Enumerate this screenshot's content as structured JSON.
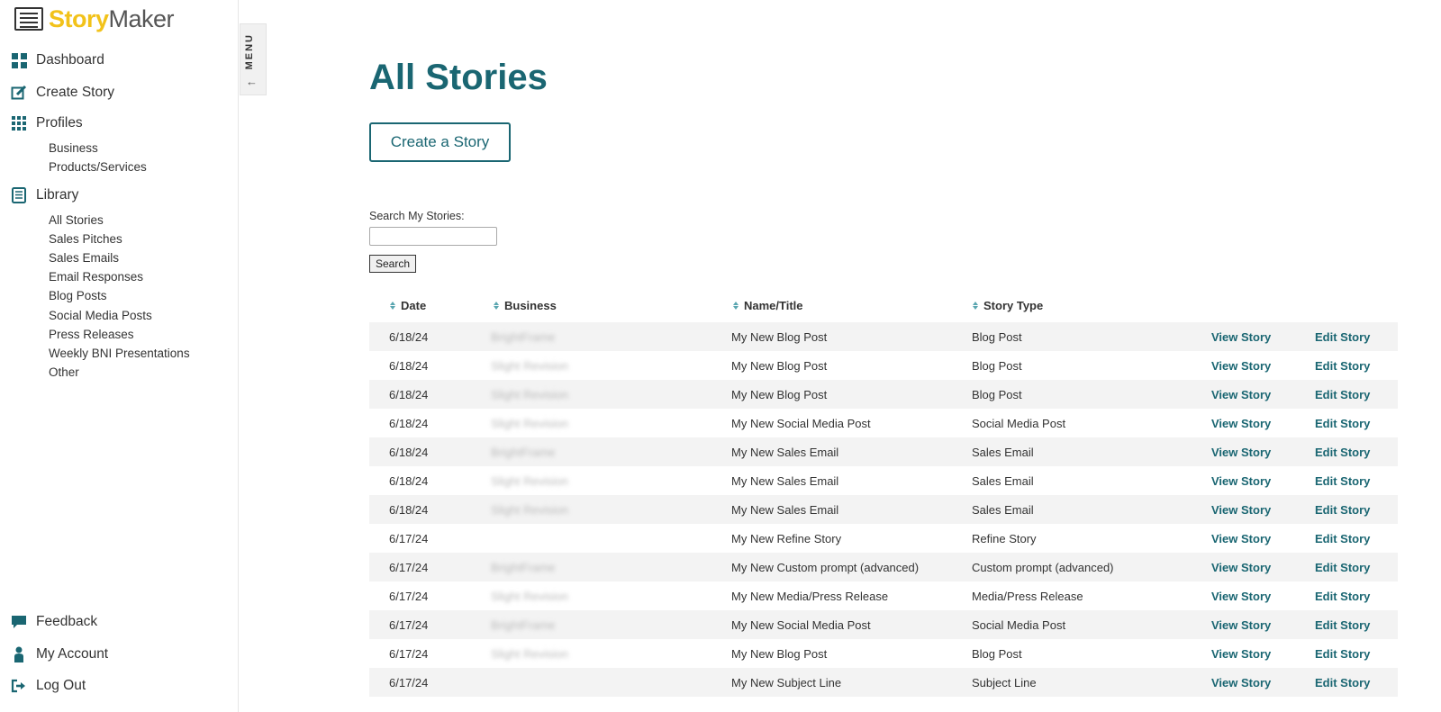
{
  "app": {
    "logo_part1": "Story",
    "logo_part2": "Maker"
  },
  "sidebar": {
    "dashboard": "Dashboard",
    "create_story": "Create Story",
    "profiles": "Profiles",
    "profiles_items": [
      "Business",
      "Products/Services"
    ],
    "library": "Library",
    "library_items": [
      "All Stories",
      "Sales Pitches",
      "Sales Emails",
      "Email Responses",
      "Blog Posts",
      "Social Media Posts",
      "Press Releases",
      "Weekly BNI Presentations",
      "Other"
    ],
    "feedback": "Feedback",
    "my_account": "My Account",
    "log_out": "Log Out"
  },
  "menu_tab": {
    "label": "MENU",
    "arrow": "←"
  },
  "main": {
    "title": "All Stories",
    "create_button": "Create a Story",
    "search_label": "Search My Stories:",
    "search_value": "",
    "search_button": "Search"
  },
  "table": {
    "headers": {
      "date": "Date",
      "business": "Business",
      "name": "Name/Title",
      "type": "Story Type"
    },
    "view_label": "View Story",
    "edit_label": "Edit Story",
    "rows": [
      {
        "date": "6/18/24",
        "business": "BrightFrame",
        "name": "My New Blog Post",
        "type": "Blog Post"
      },
      {
        "date": "6/18/24",
        "business": "Slight Revision",
        "name": "My New Blog Post",
        "type": "Blog Post"
      },
      {
        "date": "6/18/24",
        "business": "Slight Revision",
        "name": "My New Blog Post",
        "type": "Blog Post"
      },
      {
        "date": "6/18/24",
        "business": "Slight Revision",
        "name": "My New Social Media Post",
        "type": "Social Media Post"
      },
      {
        "date": "6/18/24",
        "business": "BrightFrame",
        "name": "My New Sales Email",
        "type": "Sales Email"
      },
      {
        "date": "6/18/24",
        "business": "Slight Revision",
        "name": "My New Sales Email",
        "type": "Sales Email"
      },
      {
        "date": "6/18/24",
        "business": "Slight Revision",
        "name": "My New Sales Email",
        "type": "Sales Email"
      },
      {
        "date": "6/17/24",
        "business": "",
        "name": "My New Refine Story",
        "type": "Refine Story"
      },
      {
        "date": "6/17/24",
        "business": "BrightFrame",
        "name": "My New Custom prompt (advanced)",
        "type": "Custom prompt (advanced)"
      },
      {
        "date": "6/17/24",
        "business": "Slight Revision",
        "name": "My New Media/Press Release",
        "type": "Media/Press Release"
      },
      {
        "date": "6/17/24",
        "business": "BrightFrame",
        "name": "My New Social Media Post",
        "type": "Social Media Post"
      },
      {
        "date": "6/17/24",
        "business": "Slight Revision",
        "name": "My New Blog Post",
        "type": "Blog Post"
      },
      {
        "date": "6/17/24",
        "business": "",
        "name": "My New Subject Line",
        "type": "Subject Line"
      }
    ]
  },
  "colors": {
    "brand_teal": "#1a6672",
    "logo_yellow": "#f2c21a"
  }
}
